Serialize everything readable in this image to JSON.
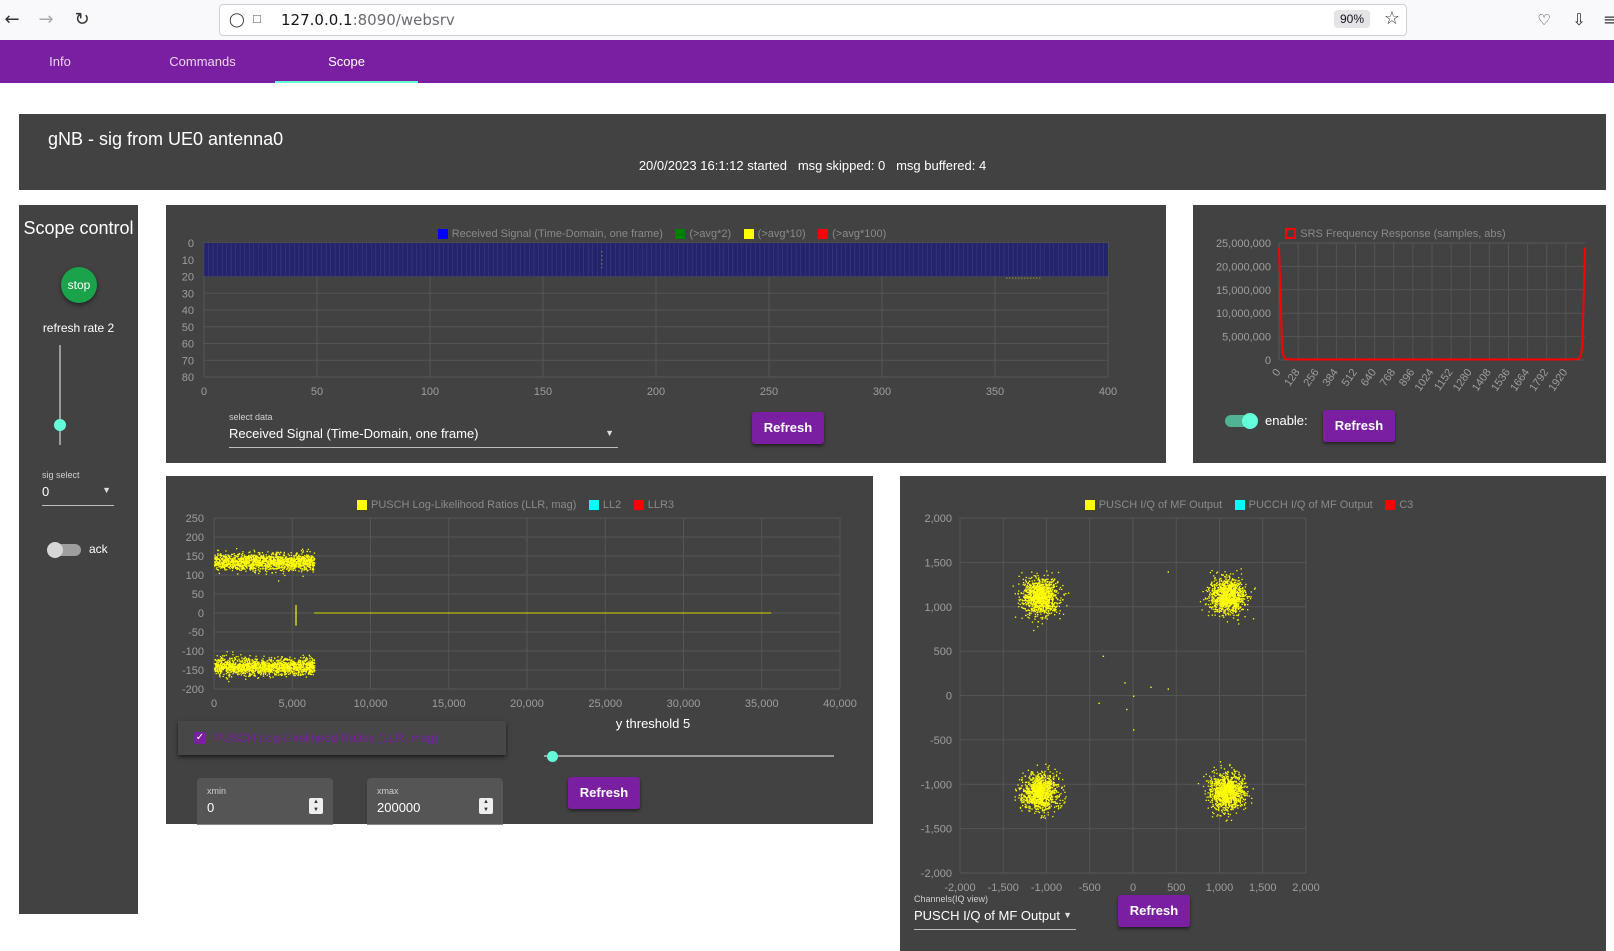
{
  "browser": {
    "url_host": "127.0.0.1",
    "url_rest": ":8090/websrv",
    "zoom": "90%"
  },
  "tabs": [
    {
      "label": "Info"
    },
    {
      "label": "Commands"
    },
    {
      "label": "Scope"
    }
  ],
  "header": {
    "title": "gNB - sig from UE0 antenna0",
    "status": "20/0/2023 16:1:12 started   msg skipped: 0   msg buffered: 4"
  },
  "scope_control": {
    "title": "Scope control",
    "stop_label": "stop",
    "refresh_rate_label": "refresh rate 2",
    "refresh_rate": 2,
    "sig_select_label": "sig select",
    "sig_select_value": "0",
    "ack_label": "ack",
    "ack_on": false
  },
  "time_panel": {
    "legend": [
      "Received Signal (Time-Domain, one frame)",
      "(>avg*2)",
      "(>avg*10)",
      "(>avg*100)"
    ],
    "select_label": "select data",
    "select_value": "Received Signal (Time-Domain, one frame)",
    "refresh_label": "Refresh"
  },
  "srs_panel": {
    "legend": "SRS Frequency Response (samples, abs)",
    "enable_label": "enable:",
    "enabled": true,
    "refresh_label": "Refresh"
  },
  "llr_panel": {
    "legend": [
      "PUSCH Log-Likelihood Ratios (LLR, mag)",
      "LL2",
      "LLR3"
    ],
    "checkbox_label": "PUSCH Log-Likelihood Ratios (LLR, mag)",
    "threshold_label": "y threshold 5",
    "xmin_label": "xmin",
    "xmin_value": "0",
    "xmax_label": "xmax",
    "xmax_value": "200000",
    "refresh_label": "Refresh"
  },
  "iq_panel": {
    "legend": [
      "PUSCH I/Q of MF Output",
      "PUCCH I/Q of MF Output",
      "C3"
    ],
    "select_label": "Channels(IQ view)",
    "select_value": "PUSCH I/Q of MF Output",
    "refresh_label": "Refresh"
  },
  "colors": {
    "accent": "#7b1fa2",
    "panel": "#424242",
    "blue": "#0000ff",
    "green": "#008000",
    "yellow": "#ffff00",
    "red": "#ff0000",
    "cyan": "#00ffff",
    "switch": "#64ffda"
  },
  "chart_data": [
    {
      "type": "heatmap",
      "name": "time-domain",
      "xlim": [
        0,
        400
      ],
      "ylim": [
        0,
        80
      ],
      "x_ticks": [
        "0",
        "50",
        "100",
        "150",
        "200",
        "250",
        "300",
        "350",
        "400"
      ],
      "y_ticks": [
        "0",
        "10",
        "20",
        "30",
        "40",
        "50",
        "60",
        "70",
        "80"
      ],
      "filled_x_range": [
        0,
        400
      ],
      "filled_y_range": [
        0,
        20
      ],
      "marks_y": [
        [
          176,
          5
        ],
        [
          176,
          15
        ],
        [
          355,
          21
        ],
        [
          370,
          21
        ]
      ]
    },
    {
      "type": "line",
      "name": "srs",
      "y_ticks": [
        "25,000,000",
        "20,000,000",
        "15,000,000",
        "10,000,000",
        "5,000,000",
        "0"
      ],
      "x_ticks": [
        "0",
        "128",
        "256",
        "384",
        "512",
        "640",
        "768",
        "896",
        "1024",
        "1152",
        "1280",
        "1408",
        "1536",
        "1664",
        "1792",
        "1920"
      ],
      "xlim": [
        0,
        2048
      ],
      "ylim": [
        0,
        25000000
      ],
      "series": [
        {
          "x": [
            0,
            10,
            20,
            30,
            40,
            60,
            100,
            1920,
            1990,
            2010,
            2020,
            2030,
            2040,
            2048
          ],
          "y": [
            24000000,
            14000000,
            3000000,
            800000,
            300000,
            150000,
            100000,
            100000,
            150000,
            300000,
            800000,
            3000000,
            14000000,
            24000000
          ]
        }
      ]
    },
    {
      "type": "scatter",
      "name": "llr",
      "xlim": [
        0,
        40000
      ],
      "ylim": [
        -200,
        250
      ],
      "x_ticks": [
        "0",
        "5,000",
        "10,000",
        "15,000",
        "20,000",
        "25,000",
        "30,000",
        "35,000",
        "40,000"
      ],
      "y_ticks": [
        "250",
        "200",
        "150",
        "100",
        "50",
        "0",
        "-50",
        "-100",
        "-150",
        "-200"
      ],
      "clusters": [
        {
          "x_range": [
            0,
            6400
          ],
          "y_center": 135,
          "y_spread": 20
        },
        {
          "x_range": [
            0,
            6400
          ],
          "y_center": -140,
          "y_spread": 20
        }
      ],
      "line": {
        "x_range": [
          6400,
          35600
        ],
        "y": 0
      }
    },
    {
      "type": "scatter",
      "name": "iq",
      "xlim": [
        -2000,
        2000
      ],
      "ylim": [
        -2000,
        2000
      ],
      "x_ticks": [
        "-2,000",
        "-1,500",
        "-1,000",
        "-500",
        "0",
        "500",
        "1,000",
        "1,500",
        "2,000"
      ],
      "y_ticks": [
        "2,000",
        "1,500",
        "1,000",
        "500",
        "0",
        "-500",
        "-1,000",
        "-1,500",
        "-2,000"
      ],
      "clusters": [
        {
          "cx": -1080,
          "cy": 1120,
          "spread": 170
        },
        {
          "cx": 1080,
          "cy": 1120,
          "spread": 170
        },
        {
          "cx": -1080,
          "cy": -1080,
          "spread": 170
        },
        {
          "cx": 1080,
          "cy": -1080,
          "spread": 170
        }
      ]
    }
  ]
}
